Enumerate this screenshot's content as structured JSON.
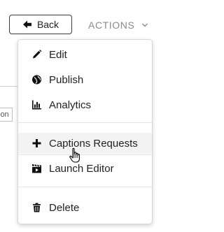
{
  "toolbar": {
    "back_label": "Back",
    "actions_label": "ACTIONS"
  },
  "background": {
    "partial_input_text": "ion"
  },
  "menu": {
    "items": [
      {
        "label": "Edit",
        "icon": "pencil-icon"
      },
      {
        "label": "Publish",
        "icon": "globe-icon"
      },
      {
        "label": "Analytics",
        "icon": "bar-chart-icon"
      },
      {
        "label": "Captions Requests",
        "icon": "plus-icon"
      },
      {
        "label": "Launch Editor",
        "icon": "clapperboard-icon"
      },
      {
        "label": "Delete",
        "icon": "trash-icon"
      }
    ],
    "hovered_item": "Captions Requests"
  },
  "colors": {
    "text": "#222222",
    "muted": "#8a8a8a",
    "border": "#d7d7d7",
    "hover_bg": "#f3f3f3"
  }
}
